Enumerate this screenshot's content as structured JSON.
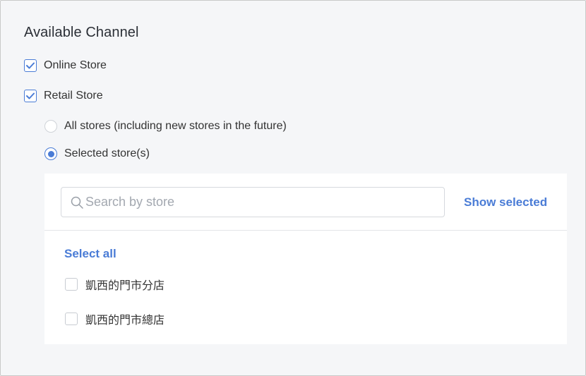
{
  "channel": {
    "title": "Available Channel",
    "online_store": {
      "label": "Online Store",
      "checked": true
    },
    "retail_store": {
      "label": "Retail Store",
      "checked": true
    }
  },
  "store_scope": {
    "options": [
      {
        "label": "All stores (including new stores in the future)",
        "selected": false
      },
      {
        "label": "Selected store(s)",
        "selected": true
      }
    ]
  },
  "store_picker": {
    "search_placeholder": "Search by store",
    "search_value": "",
    "show_selected_label": "Show selected",
    "select_all_label": "Select all",
    "stores": [
      {
        "label": "凱西的門市分店",
        "checked": false
      },
      {
        "label": "凱西的門市總店",
        "checked": false
      }
    ]
  },
  "colors": {
    "accent": "#4a7cd6",
    "background": "#f5f6f8",
    "panel": "#ffffff",
    "text": "#333333"
  },
  "icons": {
    "checked": "check-icon",
    "search": "search-icon"
  }
}
